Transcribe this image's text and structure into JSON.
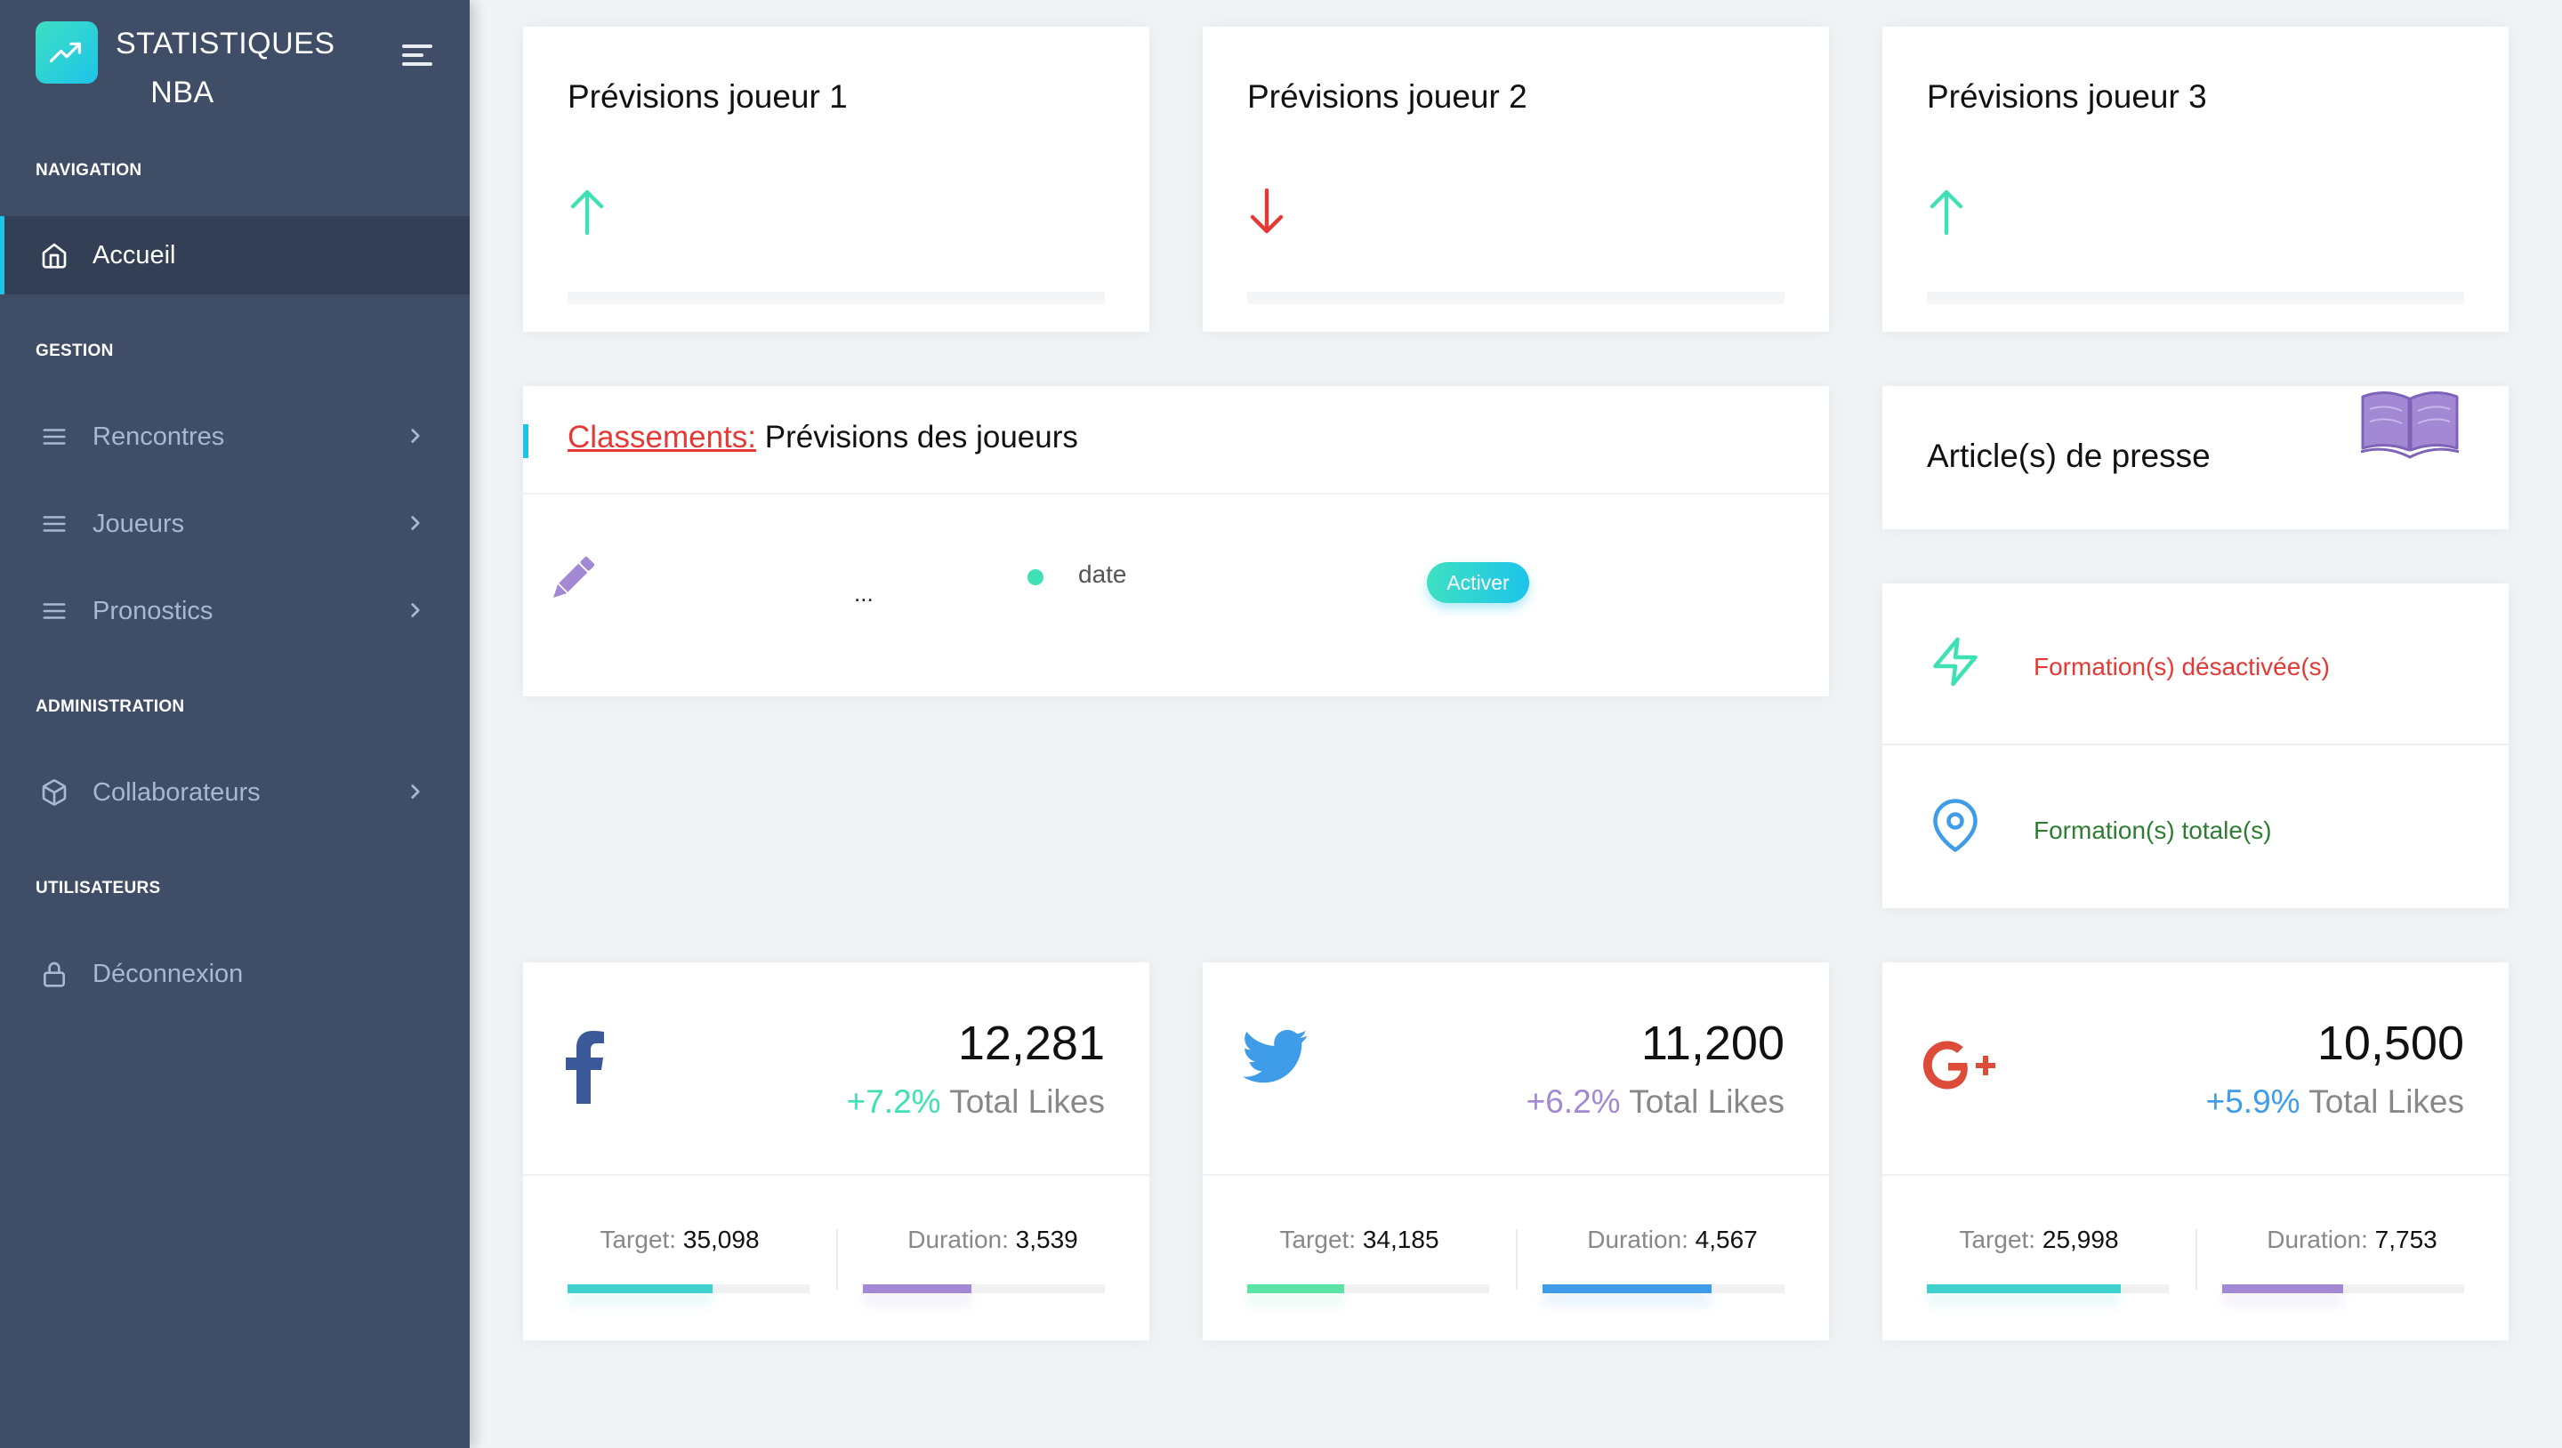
{
  "brand": {
    "title_line1": "STATISTIQUES",
    "title_line2": "NBA"
  },
  "sidebar": {
    "sections": {
      "navigation": "NAVIGATION",
      "gestion": "GESTION",
      "administration": "ADMINISTRATION",
      "utilisateurs": "UTILISATEURS"
    },
    "items": {
      "accueil": "Accueil",
      "rencontres": "Rencontres",
      "joueurs": "Joueurs",
      "pronostics": "Pronostics",
      "collaborateurs": "Collaborateurs",
      "deconnexion": "Déconnexion"
    }
  },
  "predictions": [
    {
      "title": "Prévisions joueur 1",
      "trend": "up",
      "icon": "arrow-up-icon",
      "color": "#3ee0b4"
    },
    {
      "title": "Prévisions joueur 2",
      "trend": "down",
      "icon": "arrow-down-icon",
      "color": "#e53935"
    },
    {
      "title": "Prévisions joueur 3",
      "trend": "up",
      "icon": "arrow-up-icon",
      "color": "#3ee0b4"
    }
  ],
  "rankings": {
    "title_lead": "Classements:",
    "title_rest": " Prévisions des joueurs",
    "row": {
      "name": "...",
      "date": "date",
      "button": "Activer"
    }
  },
  "press": {
    "title": "Article(s) de presse",
    "icon": "book-icon"
  },
  "formations": {
    "disabled": {
      "label": "Formation(s) désactivée(s)",
      "color": "#e53935",
      "icon": "zap-icon"
    },
    "total": {
      "label": "Formation(s) totale(s)",
      "color": "#2e7d32",
      "icon": "map-pin-icon"
    }
  },
  "social": [
    {
      "network": "facebook",
      "icon": "facebook-icon",
      "count": "12,281",
      "growth": "+7.2%",
      "growth_color": "#3ee0b4",
      "likes_label": " Total Likes",
      "target_label": "Target:",
      "target": "35,098",
      "duration_label": "Duration:",
      "duration": "3,539",
      "target_fill": 0.6,
      "duration_fill": 0.45,
      "target_color": "#3fd1cf",
      "duration_color": "#a389d4"
    },
    {
      "network": "twitter",
      "icon": "twitter-icon",
      "count": "11,200",
      "growth": "+6.2%",
      "growth_color": "#a389d4",
      "likes_label": " Total Likes",
      "target_label": "Target:",
      "target": "34,185",
      "duration_label": "Duration:",
      "duration": "4,567",
      "target_fill": 0.4,
      "duration_fill": 0.7,
      "target_color": "#5ae3a5",
      "duration_color": "#3f9ce8"
    },
    {
      "network": "google-plus",
      "icon": "google-plus-icon",
      "count": "10,500",
      "growth": "+5.9%",
      "growth_color": "#3f9ce8",
      "likes_label": " Total Likes",
      "target_label": "Target:",
      "target": "25,998",
      "duration_label": "Duration:",
      "duration": "7,753",
      "target_fill": 0.8,
      "duration_fill": 0.5,
      "target_color": "#3fd1cf",
      "duration_color": "#a389d4"
    }
  ]
}
